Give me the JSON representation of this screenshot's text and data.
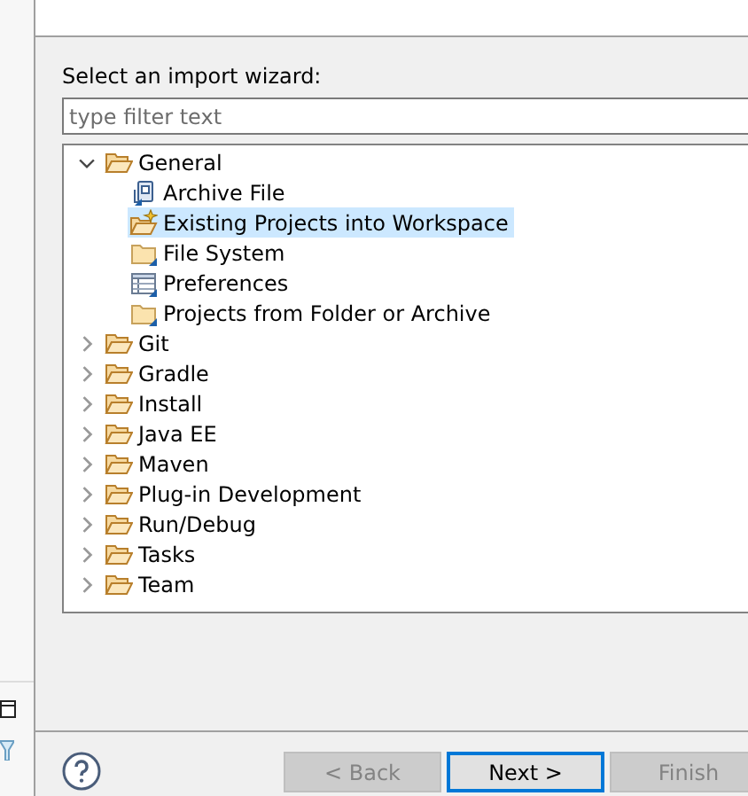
{
  "dialog": {
    "prompt": "Select an import wizard:",
    "filter": {
      "placeholder": "type filter text"
    },
    "tree": [
      {
        "label": "General",
        "expanded": true,
        "children": [
          {
            "label": "Archive File",
            "kind": "archive",
            "selected": false
          },
          {
            "label": "Existing Projects into Workspace",
            "kind": "project",
            "selected": true
          },
          {
            "label": "File System",
            "kind": "folder",
            "selected": false
          },
          {
            "label": "Preferences",
            "kind": "preferences",
            "selected": false
          },
          {
            "label": "Projects from Folder or Archive",
            "kind": "folder",
            "selected": false
          }
        ]
      },
      {
        "label": "Git",
        "expanded": false
      },
      {
        "label": "Gradle",
        "expanded": false
      },
      {
        "label": "Install",
        "expanded": false
      },
      {
        "label": "Java EE",
        "expanded": false
      },
      {
        "label": "Maven",
        "expanded": false
      },
      {
        "label": "Plug-in Development",
        "expanded": false
      },
      {
        "label": "Run/Debug",
        "expanded": false
      },
      {
        "label": "Tasks",
        "expanded": false
      },
      {
        "label": "Team",
        "expanded": false
      }
    ],
    "buttons": [
      {
        "label": "< Back",
        "disabled": true,
        "default": false
      },
      {
        "label": "Next >",
        "disabled": false,
        "default": true
      },
      {
        "label": "Finish",
        "disabled": true,
        "default": false
      }
    ]
  }
}
